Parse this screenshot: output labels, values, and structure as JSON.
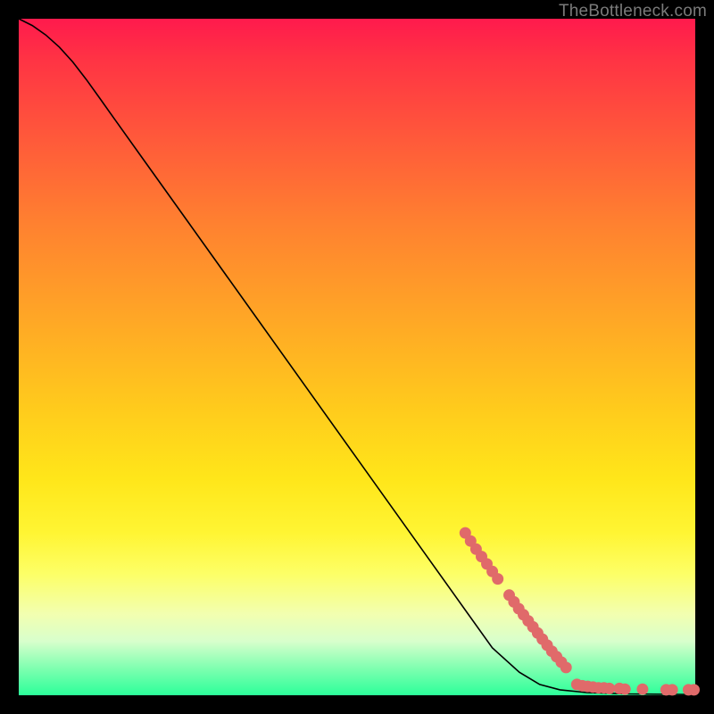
{
  "watermark": "TheBottleneck.com",
  "colors": {
    "dot": "#e06a6a",
    "line": "#000000",
    "frame": "#000000"
  },
  "chart_data": {
    "type": "line",
    "xlim": [
      0,
      100
    ],
    "ylim": [
      0,
      100
    ],
    "xlabel": "",
    "ylabel": "",
    "title": "",
    "curve": [
      {
        "x": 0.0,
        "y": 100.0
      },
      {
        "x": 2.0,
        "y": 99.0
      },
      {
        "x": 4.0,
        "y": 97.6
      },
      {
        "x": 6.0,
        "y": 95.8
      },
      {
        "x": 8.0,
        "y": 93.6
      },
      {
        "x": 10.0,
        "y": 91.0
      },
      {
        "x": 12.0,
        "y": 88.2
      },
      {
        "x": 14.0,
        "y": 85.4
      },
      {
        "x": 18.0,
        "y": 79.8
      },
      {
        "x": 25.0,
        "y": 70.0
      },
      {
        "x": 35.0,
        "y": 56.0
      },
      {
        "x": 50.0,
        "y": 35.0
      },
      {
        "x": 60.0,
        "y": 21.0
      },
      {
        "x": 66.0,
        "y": 12.6
      },
      {
        "x": 70.0,
        "y": 7.0
      },
      {
        "x": 74.0,
        "y": 3.4
      },
      {
        "x": 77.0,
        "y": 1.6
      },
      {
        "x": 80.0,
        "y": 0.8
      },
      {
        "x": 84.0,
        "y": 0.4
      },
      {
        "x": 90.0,
        "y": 0.2
      },
      {
        "x": 100.0,
        "y": 0.1
      }
    ],
    "dot_cluster_upper": [
      {
        "x": 66.0,
        "y": 24.0
      },
      {
        "x": 66.8,
        "y": 22.8
      },
      {
        "x": 67.6,
        "y": 21.6
      },
      {
        "x": 68.4,
        "y": 20.5
      },
      {
        "x": 69.2,
        "y": 19.4
      },
      {
        "x": 70.0,
        "y": 18.3
      },
      {
        "x": 70.8,
        "y": 17.2
      }
    ],
    "dot_cluster_mid": [
      {
        "x": 72.5,
        "y": 14.8
      },
      {
        "x": 73.2,
        "y": 13.8
      },
      {
        "x": 73.9,
        "y": 12.8
      },
      {
        "x": 74.6,
        "y": 11.9
      },
      {
        "x": 75.3,
        "y": 11.0
      },
      {
        "x": 76.0,
        "y": 10.1
      },
      {
        "x": 76.7,
        "y": 9.2
      },
      {
        "x": 77.4,
        "y": 8.3
      },
      {
        "x": 78.1,
        "y": 7.4
      },
      {
        "x": 78.8,
        "y": 6.5
      },
      {
        "x": 79.5,
        "y": 5.7
      },
      {
        "x": 80.2,
        "y": 4.9
      },
      {
        "x": 80.9,
        "y": 4.1
      }
    ],
    "dot_cluster_bottom": [
      {
        "x": 82.5,
        "y": 1.6
      },
      {
        "x": 83.3,
        "y": 1.4
      },
      {
        "x": 84.1,
        "y": 1.3
      },
      {
        "x": 84.9,
        "y": 1.2
      },
      {
        "x": 85.7,
        "y": 1.1
      },
      {
        "x": 86.5,
        "y": 1.1
      },
      {
        "x": 87.3,
        "y": 1.0
      },
      {
        "x": 88.8,
        "y": 1.0
      },
      {
        "x": 89.6,
        "y": 0.9
      },
      {
        "x": 92.2,
        "y": 0.9
      },
      {
        "x": 95.7,
        "y": 0.8
      },
      {
        "x": 96.6,
        "y": 0.8
      },
      {
        "x": 99.0,
        "y": 0.8
      },
      {
        "x": 99.8,
        "y": 0.8
      }
    ]
  }
}
